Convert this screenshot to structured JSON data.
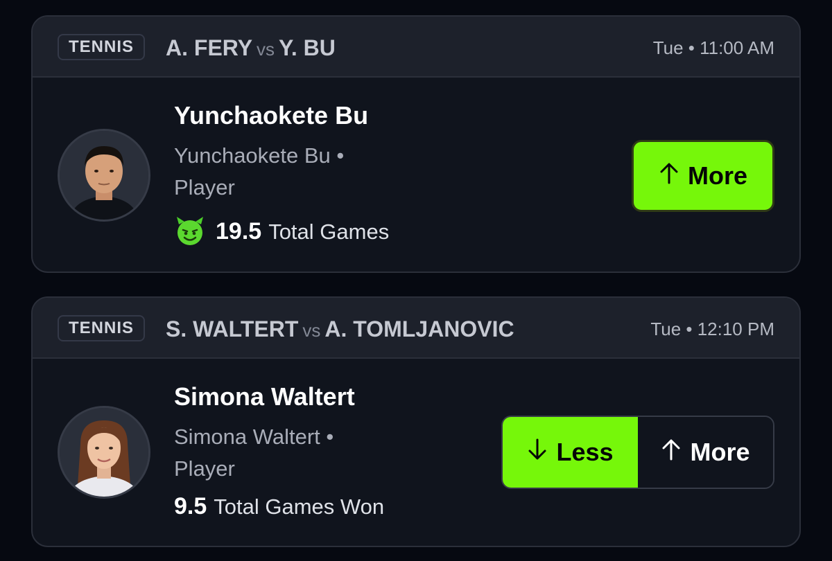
{
  "cards": [
    {
      "sport": "TENNIS",
      "team_a": "A. FERY",
      "vs": "vs",
      "team_b": "Y. BU",
      "time": "Tue • 11:00 AM",
      "player_name": "Yunchaokete Bu",
      "team_line_1": "Yunchaokete Bu •",
      "team_line_2": "Player",
      "stat_value": "19.5",
      "stat_label": "Total Games",
      "icon": "demon-icon",
      "more_label": "More"
    },
    {
      "sport": "TENNIS",
      "team_a": "S. WALTERT",
      "vs": "vs",
      "team_b": "A. TOMLJANOVIC",
      "time": "Tue • 12:10 PM",
      "player_name": "Simona Waltert",
      "team_line_1": "Simona Waltert •",
      "team_line_2": "Player",
      "stat_value": "9.5",
      "stat_label": "Total Games Won",
      "less_label": "Less",
      "more_label": "More",
      "selected": "less"
    }
  ],
  "colors": {
    "accent": "#76f70a",
    "card_bg": "#10141d",
    "header_bg": "#1d212b",
    "page_bg": "#060911"
  }
}
